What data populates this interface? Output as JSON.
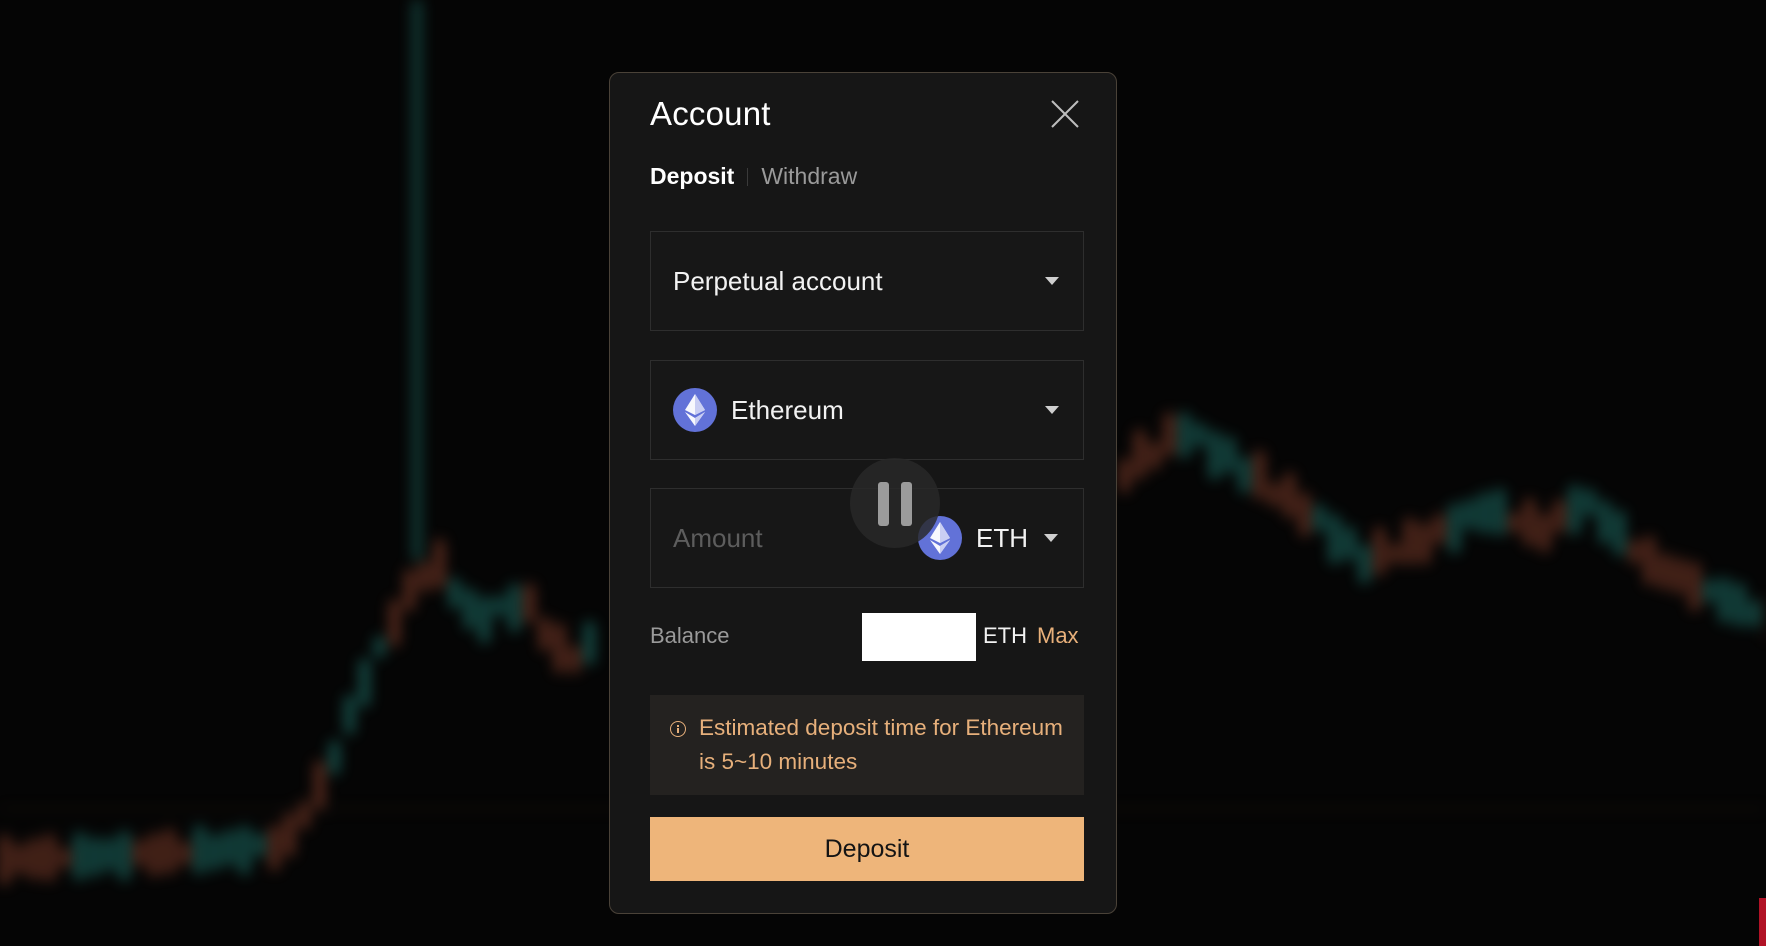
{
  "modal": {
    "title": "Account",
    "tabs": [
      {
        "label": "Deposit",
        "active": true
      },
      {
        "label": "Withdraw",
        "active": false
      }
    ],
    "account_select": {
      "value": "Perpetual account"
    },
    "asset_select": {
      "value": "Ethereum",
      "icon": "ethereum-icon"
    },
    "amount": {
      "placeholder": "Amount",
      "value": "",
      "unit": "ETH",
      "unit_icon": "ethereum-icon"
    },
    "balance": {
      "label": "Balance",
      "unit": "ETH",
      "max_label": "Max"
    },
    "notice": {
      "icon": "info-icon",
      "text": "Estimated deposit time for Ethereum is 5~10 minutes"
    },
    "submit_label": "Deposit"
  },
  "colors": {
    "accent": "#eeb57a",
    "notice_text": "#e7b07b",
    "modal_background": "#161616",
    "ethereum": "#6272d8"
  }
}
